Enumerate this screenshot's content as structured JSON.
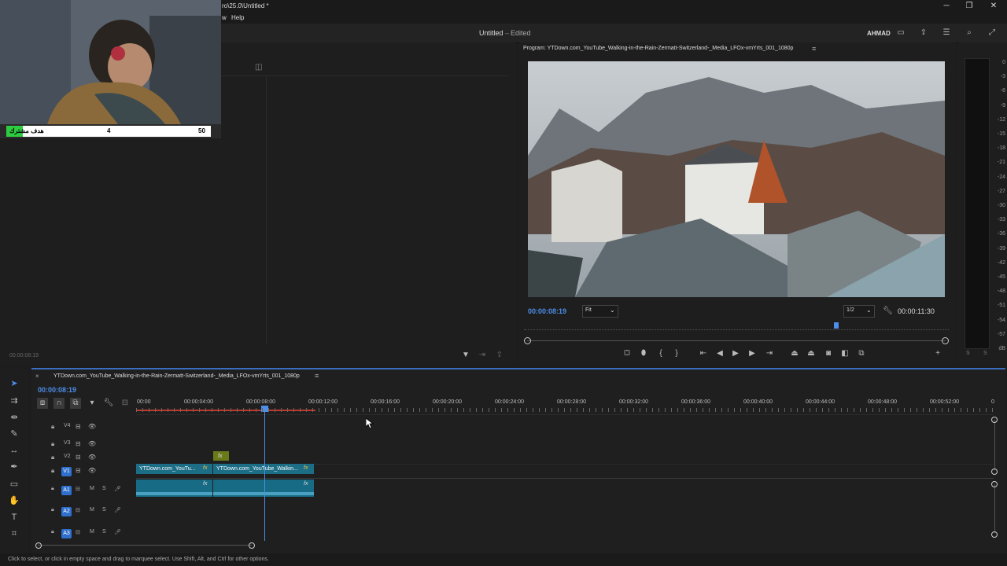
{
  "window": {
    "title": "ro\\25.0\\Untitled *",
    "minimize": "─",
    "restore": "❐",
    "close": "✕"
  },
  "menu": {
    "frag": "w",
    "help": "Help"
  },
  "header": {
    "project_name": "Untitled",
    "status": "Edited",
    "user": "AHMAD"
  },
  "webcam": {
    "counter_label": "هدف مشترك",
    "current": "4",
    "goal": "50",
    "progress": 0.08
  },
  "source_panel": {
    "timecode": "00:00:08:19"
  },
  "program": {
    "title": "Program: YTDown.com_YouTube_Walking-in-the-Rain-Zermatt-Switzerland-_Media_LFOx-vmYrts_001_1080p",
    "timecode": "00:00:08:19",
    "fit": "Fit",
    "resolution": "1/2",
    "duration": "00:00:11:30",
    "playhead_position": 0.73
  },
  "meters": {
    "labels": [
      "0",
      "-3",
      "-6",
      "-9",
      "-12",
      "-15",
      "-18",
      "-21",
      "-24",
      "-27",
      "-30",
      "-33",
      "-36",
      "-39",
      "-42",
      "-45",
      "-48",
      "-51",
      "-54",
      "-57",
      "dB"
    ],
    "solo_left": "S",
    "solo_right": "S"
  },
  "timeline": {
    "sequence_name": "YTDown.com_YouTube_Walking-in-the-Rain-Zermatt-Switzerland-_Media_LFOx-vmYrts_001_1080p",
    "timecode": "00:00:08:19",
    "ruler": [
      "00:00",
      "00:00:04:00",
      "00:00:08:00",
      "00:00:12:00",
      "00:00:16:00",
      "00:00:20:00",
      "00:00:24:00",
      "00:00:28:00",
      "00:00:32:00",
      "00:00:36:00",
      "00:00:40:00",
      "00:00:44:00",
      "00:00:48:00",
      "00:00:52:00",
      "0"
    ],
    "video_tracks": [
      "V4",
      "V3",
      "V2",
      "V1"
    ],
    "audio_tracks": [
      "A1",
      "A2",
      "A3"
    ],
    "mute": "M",
    "solo": "S",
    "clip1": "YTDown.com_YouTu...",
    "clip2": "YTDown.com_YouTube_Walkin...",
    "fx": "fx"
  },
  "status": {
    "hint": "Click to select, or click in empty space and drag to marquee select. Use Shift, Alt, and Ctrl for other options."
  },
  "colors": {
    "accent": "#3a6ec0",
    "clip": "#1c6d86",
    "timecode": "#4d8ee8"
  }
}
